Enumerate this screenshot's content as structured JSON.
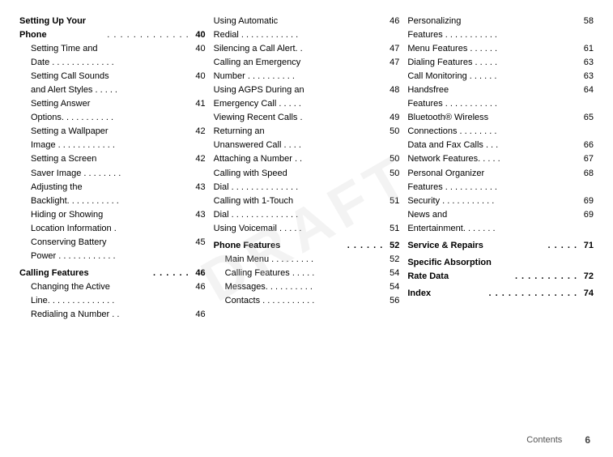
{
  "watermark": "DRAFT",
  "footer": {
    "label": "Contents",
    "page": "6"
  },
  "columns": [
    {
      "id": "col1",
      "sections": [
        {
          "type": "header",
          "text": "Setting Up Your"
        },
        {
          "type": "header-bold",
          "text": "Phone",
          "dots": ". . . . . . . . . . . . .",
          "page": "40"
        },
        {
          "type": "items",
          "items": [
            {
              "indent": 1,
              "label": "Setting Time and",
              "label2": "Date . . . . . . . . . . . . .",
              "page": "40"
            },
            {
              "indent": 1,
              "label": "Setting Call Sounds",
              "label2": "and Alert Styles  . . . . .",
              "page": "40"
            },
            {
              "indent": 1,
              "label": "Setting Answer",
              "label2": "Options. . . . . . . . . . .",
              "page": "41"
            },
            {
              "indent": 1,
              "label": "Setting a Wallpaper",
              "label2": "Image . . . . . . . . . . . .",
              "page": "42"
            },
            {
              "indent": 1,
              "label": "Setting a Screen",
              "label2": "Saver Image . . . . . . . .",
              "page": "42"
            },
            {
              "indent": 1,
              "label": "Adjusting the",
              "label2": "Backlight. . . . . . . . . . .",
              "page": "43"
            },
            {
              "indent": 1,
              "label": "Hiding or Showing",
              "label2": "Location Information  .",
              "page": "43"
            },
            {
              "indent": 1,
              "label": "Conserving Battery",
              "label2": "Power . . . . . . . . . . . .",
              "page": "45"
            }
          ]
        },
        {
          "type": "header-bold-inline",
          "text": "Calling Features",
          "dots": " . . . . . .",
          "page": "46"
        },
        {
          "type": "items",
          "items": [
            {
              "indent": 1,
              "label": "Changing the Active",
              "label2": "Line. . . . . . . . . . . . . .",
              "page": "46"
            },
            {
              "indent": 1,
              "label": "Redialing a Number  . .",
              "page": "46"
            }
          ]
        }
      ]
    },
    {
      "id": "col2",
      "sections": [
        {
          "type": "items",
          "items": [
            {
              "indent": 0,
              "label": "Using Automatic",
              "label2": "Redial . . . . . . . . . . . .",
              "page": "46"
            },
            {
              "indent": 0,
              "label": "Silencing a Call Alert. .",
              "page": "47"
            },
            {
              "indent": 0,
              "label": "Calling an Emergency",
              "label2": "Number  . . . . . . . . . .",
              "page": "47"
            },
            {
              "indent": 0,
              "label": "Using AGPS During an",
              "label2": "Emergency Call  . . . . .",
              "page": "48"
            },
            {
              "indent": 0,
              "label": "Viewing Recent Calls  .",
              "page": "49"
            },
            {
              "indent": 0,
              "label": "Returning an",
              "label2": "Unanswered Call  . . . .",
              "page": "50"
            },
            {
              "indent": 0,
              "label": "Attaching a Number . .",
              "page": "50"
            },
            {
              "indent": 0,
              "label": "Calling with Speed",
              "label2": "Dial . . . . . . . . . . . . . .",
              "page": "50"
            },
            {
              "indent": 0,
              "label": "Calling with 1-Touch",
              "label2": "Dial . . . . . . . . . . . . . .",
              "page": "51"
            },
            {
              "indent": 0,
              "label": "Using Voicemail  . . . . .",
              "page": "51"
            }
          ]
        },
        {
          "type": "header-bold-inline",
          "text": "Phone Features",
          "dots": " . . . . . .",
          "page": "52"
        },
        {
          "type": "items",
          "items": [
            {
              "indent": 1,
              "label": "Main Menu . . . . . . . . .",
              "page": "52"
            },
            {
              "indent": 1,
              "label": "Calling Features  . . . . .",
              "page": "54"
            },
            {
              "indent": 1,
              "label": "Messages. . . . . . . . . .",
              "page": "54"
            },
            {
              "indent": 1,
              "label": "Contacts . . . . . . . . . . .",
              "page": "56"
            }
          ]
        }
      ]
    },
    {
      "id": "col3",
      "sections": [
        {
          "type": "items",
          "items": [
            {
              "indent": 0,
              "label": "Personalizing",
              "label2": "Features . . . . . . . . . . .",
              "page": "58"
            },
            {
              "indent": 0,
              "label": "Menu Features . . . . . .",
              "page": "61"
            },
            {
              "indent": 0,
              "label": "Dialing Features  . . . . .",
              "page": "63"
            },
            {
              "indent": 0,
              "label": "Call Monitoring . . . . . .",
              "page": "63"
            },
            {
              "indent": 0,
              "label": "Handsfree",
              "label2": "Features . . . . . . . . . . .",
              "page": "64"
            },
            {
              "indent": 0,
              "label": "Bluetooth® Wireless",
              "label2": "Connections . . . . . . . .",
              "page": "65"
            },
            {
              "indent": 0,
              "label": "Data and Fax Calls  . . .",
              "page": "66"
            },
            {
              "indent": 0,
              "label": "Network Features. . . . .",
              "page": "67"
            },
            {
              "indent": 0,
              "label": "Personal Organizer",
              "label2": "Features . . . . . . . . . . .",
              "page": "68"
            },
            {
              "indent": 0,
              "label": "Security  . . . . . . . . . . .",
              "page": "69"
            },
            {
              "indent": 0,
              "label": "News and",
              "label2": "Entertainment. . . . . . .",
              "page": "69"
            }
          ]
        },
        {
          "type": "header-bold-inline",
          "text": "Service & Repairs",
          "dots": " . . . . .",
          "page": "71"
        },
        {
          "type": "header-bold-inline",
          "text": "Specific Absorption",
          "text2": "Rate Data",
          "dots": "  . . . . . . . . . .",
          "page": "72"
        },
        {
          "type": "header-bold-inline",
          "text": "Index",
          "dots": ". . . . . . . . . . . . . .",
          "page": "74"
        }
      ]
    }
  ]
}
